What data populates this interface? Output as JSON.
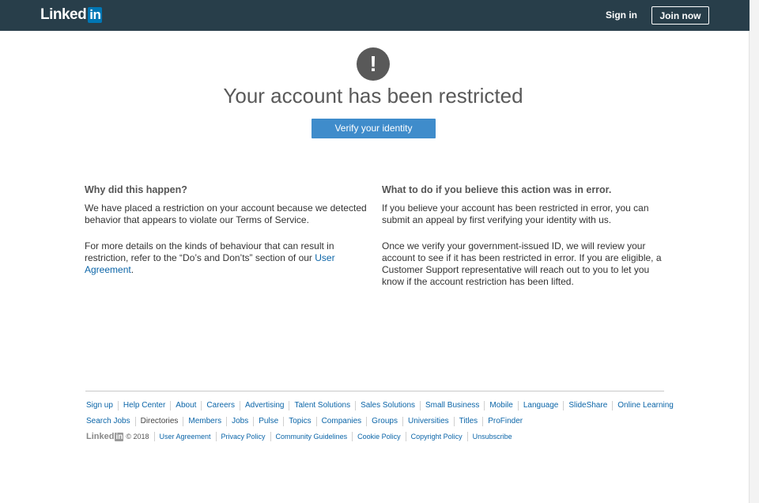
{
  "header": {
    "logo_text": "Linked",
    "logo_badge": "in",
    "sign_in": "Sign in",
    "join_now": "Join now"
  },
  "main": {
    "alert_glyph": "!",
    "title": "Your account has been restricted",
    "verify_button": "Verify your identity"
  },
  "left_column": {
    "heading": "Why did this happen?",
    "para1": "We have placed a restriction on your account because we detected behavior that appears to violate our Terms of Service.",
    "para2_prefix": "For more details on the kinds of behaviour that can result in restriction, refer to the “Do’s and Don’ts” section of our ",
    "para2_link": "User Agreement",
    "para2_suffix": "."
  },
  "right_column": {
    "heading": "What to do if you believe this action was in error.",
    "para1": "If you believe your account has been restricted in error, you can submit an appeal by first verifying your identity with us.",
    "para2": "Once we verify your government-issued ID, we will review your account to see if it has been restricted in error. If you are eligible, a Customer Support representative will reach out to you to let you know if the account restriction has been lifted."
  },
  "footer": {
    "row1": [
      "Sign up",
      "Help Center",
      "About",
      "Careers",
      "Advertising",
      "Talent Solutions",
      "Sales Solutions",
      "Small Business",
      "Mobile",
      "Language",
      "SlideShare",
      "Online Learning"
    ],
    "row2": [
      "Search Jobs",
      "Directories",
      "Members",
      "Jobs",
      "Pulse",
      "Topics",
      "Companies",
      "Groups",
      "Universities",
      "Titles",
      "ProFinder"
    ],
    "logo_text": "Linked",
    "logo_badge": "in",
    "copyright": "© 2018",
    "row3": [
      "User Agreement",
      "Privacy Policy",
      "Community Guidelines",
      "Cookie Policy",
      "Copyright Policy",
      "Unsubscribe"
    ]
  },
  "colors": {
    "header_bg": "#283e4a",
    "brand_blue": "#0077b5",
    "button_blue": "#3f8ccb",
    "link_blue": "#0b65a8"
  }
}
